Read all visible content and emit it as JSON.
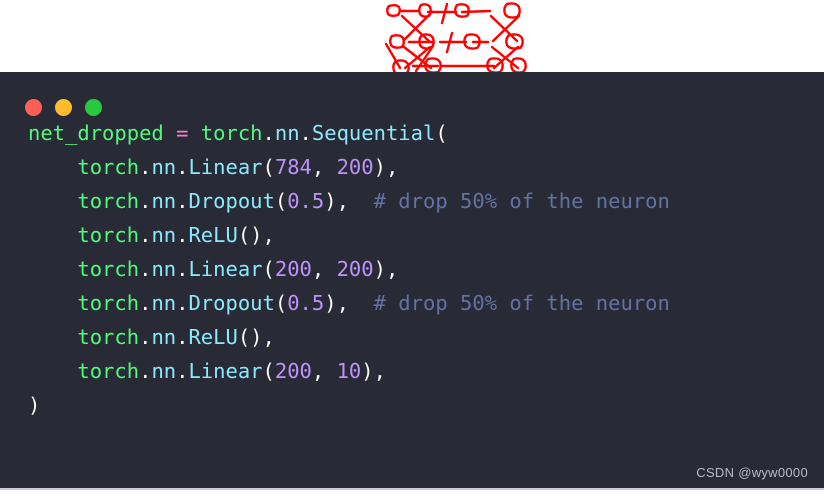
{
  "doodle": {
    "label": "neural-network-dropout-sketch",
    "stroke_color": "#ff0000",
    "description": "hand-drawn red neural network with crossed-out connections"
  },
  "window": {
    "background": "#282a36",
    "traffic_lights": [
      {
        "name": "close",
        "color": "#ff5f56"
      },
      {
        "name": "minimize",
        "color": "#ffbd2e"
      },
      {
        "name": "maximize",
        "color": "#27c93f"
      }
    ]
  },
  "code": {
    "language": "python",
    "lines": [
      {
        "n": 1,
        "indent": 0,
        "tokens": [
          {
            "t": "net_dropped",
            "c": "var"
          },
          {
            "t": " ",
            "c": "punc"
          },
          {
            "t": "=",
            "c": "op"
          },
          {
            "t": " ",
            "c": "punc"
          },
          {
            "t": "torch",
            "c": "mod"
          },
          {
            "t": ".",
            "c": "punc"
          },
          {
            "t": "nn",
            "c": "attr"
          },
          {
            "t": ".",
            "c": "punc"
          },
          {
            "t": "Sequential",
            "c": "fn"
          },
          {
            "t": "(",
            "c": "punc"
          }
        ]
      },
      {
        "n": 2,
        "indent": 4,
        "tokens": [
          {
            "t": "torch",
            "c": "mod"
          },
          {
            "t": ".",
            "c": "punc"
          },
          {
            "t": "nn",
            "c": "attr"
          },
          {
            "t": ".",
            "c": "punc"
          },
          {
            "t": "Linear",
            "c": "fn"
          },
          {
            "t": "(",
            "c": "punc"
          },
          {
            "t": "784",
            "c": "num"
          },
          {
            "t": ", ",
            "c": "punc"
          },
          {
            "t": "200",
            "c": "num"
          },
          {
            "t": "),",
            "c": "punc"
          }
        ]
      },
      {
        "n": 3,
        "indent": 4,
        "tokens": [
          {
            "t": "torch",
            "c": "mod"
          },
          {
            "t": ".",
            "c": "punc"
          },
          {
            "t": "nn",
            "c": "attr"
          },
          {
            "t": ".",
            "c": "punc"
          },
          {
            "t": "Dropout",
            "c": "fn"
          },
          {
            "t": "(",
            "c": "punc"
          },
          {
            "t": "0.5",
            "c": "num"
          },
          {
            "t": "),  ",
            "c": "punc"
          },
          {
            "t": "# drop 50% of the neuron",
            "c": "cmt"
          }
        ]
      },
      {
        "n": 4,
        "indent": 4,
        "tokens": [
          {
            "t": "torch",
            "c": "mod"
          },
          {
            "t": ".",
            "c": "punc"
          },
          {
            "t": "nn",
            "c": "attr"
          },
          {
            "t": ".",
            "c": "punc"
          },
          {
            "t": "ReLU",
            "c": "fn"
          },
          {
            "t": "(),",
            "c": "punc"
          }
        ]
      },
      {
        "n": 5,
        "indent": 4,
        "tokens": [
          {
            "t": "torch",
            "c": "mod"
          },
          {
            "t": ".",
            "c": "punc"
          },
          {
            "t": "nn",
            "c": "attr"
          },
          {
            "t": ".",
            "c": "punc"
          },
          {
            "t": "Linear",
            "c": "fn"
          },
          {
            "t": "(",
            "c": "punc"
          },
          {
            "t": "200",
            "c": "num"
          },
          {
            "t": ", ",
            "c": "punc"
          },
          {
            "t": "200",
            "c": "num"
          },
          {
            "t": "),",
            "c": "punc"
          }
        ]
      },
      {
        "n": 6,
        "indent": 4,
        "tokens": [
          {
            "t": "torch",
            "c": "mod"
          },
          {
            "t": ".",
            "c": "punc"
          },
          {
            "t": "nn",
            "c": "attr"
          },
          {
            "t": ".",
            "c": "punc"
          },
          {
            "t": "Dropout",
            "c": "fn"
          },
          {
            "t": "(",
            "c": "punc"
          },
          {
            "t": "0.5",
            "c": "num"
          },
          {
            "t": "),  ",
            "c": "punc"
          },
          {
            "t": "# drop 50% of the neuron",
            "c": "cmt"
          }
        ]
      },
      {
        "n": 7,
        "indent": 4,
        "tokens": [
          {
            "t": "torch",
            "c": "mod"
          },
          {
            "t": ".",
            "c": "punc"
          },
          {
            "t": "nn",
            "c": "attr"
          },
          {
            "t": ".",
            "c": "punc"
          },
          {
            "t": "ReLU",
            "c": "fn"
          },
          {
            "t": "(),",
            "c": "punc"
          }
        ]
      },
      {
        "n": 8,
        "indent": 4,
        "tokens": [
          {
            "t": "torch",
            "c": "mod"
          },
          {
            "t": ".",
            "c": "punc"
          },
          {
            "t": "nn",
            "c": "attr"
          },
          {
            "t": ".",
            "c": "punc"
          },
          {
            "t": "Linear",
            "c": "fn"
          },
          {
            "t": "(",
            "c": "punc"
          },
          {
            "t": "200",
            "c": "num"
          },
          {
            "t": ", ",
            "c": "punc"
          },
          {
            "t": "10",
            "c": "num"
          },
          {
            "t": "),",
            "c": "punc"
          }
        ]
      },
      {
        "n": 9,
        "indent": 0,
        "tokens": [
          {
            "t": ")",
            "c": "punc"
          }
        ]
      }
    ]
  },
  "watermark": {
    "text": "CSDN @wyw0000"
  },
  "palette": {
    "code_background": "#282a36",
    "default_text": "#f8f8f2",
    "variable": "#50fa7b",
    "module": "#50fa7b",
    "attribute": "#8be9fd",
    "function": "#8be9fd",
    "number": "#bd93f9",
    "operator": "#ff79c6",
    "comment": "#6272a4",
    "doodle": "#ff0000",
    "page_background": "#ffffff"
  }
}
